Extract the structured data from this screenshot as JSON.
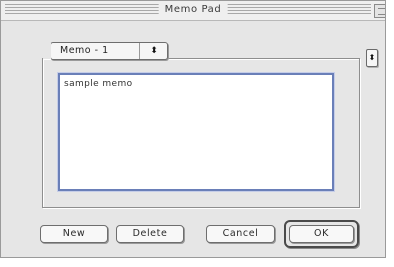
{
  "window": {
    "title": "Memo Pad"
  },
  "memo_selector": {
    "selected": "Memo - 1",
    "arrows_glyph": "⬍"
  },
  "stepper": {
    "glyph": "⬍"
  },
  "memo": {
    "text": "sample memo"
  },
  "buttons": {
    "new": "New",
    "delete": "Delete",
    "cancel": "Cancel",
    "ok": "OK"
  },
  "colors": {
    "window_bg": "#e6e6e6",
    "text_focus_ring": "#6a7fb8"
  }
}
